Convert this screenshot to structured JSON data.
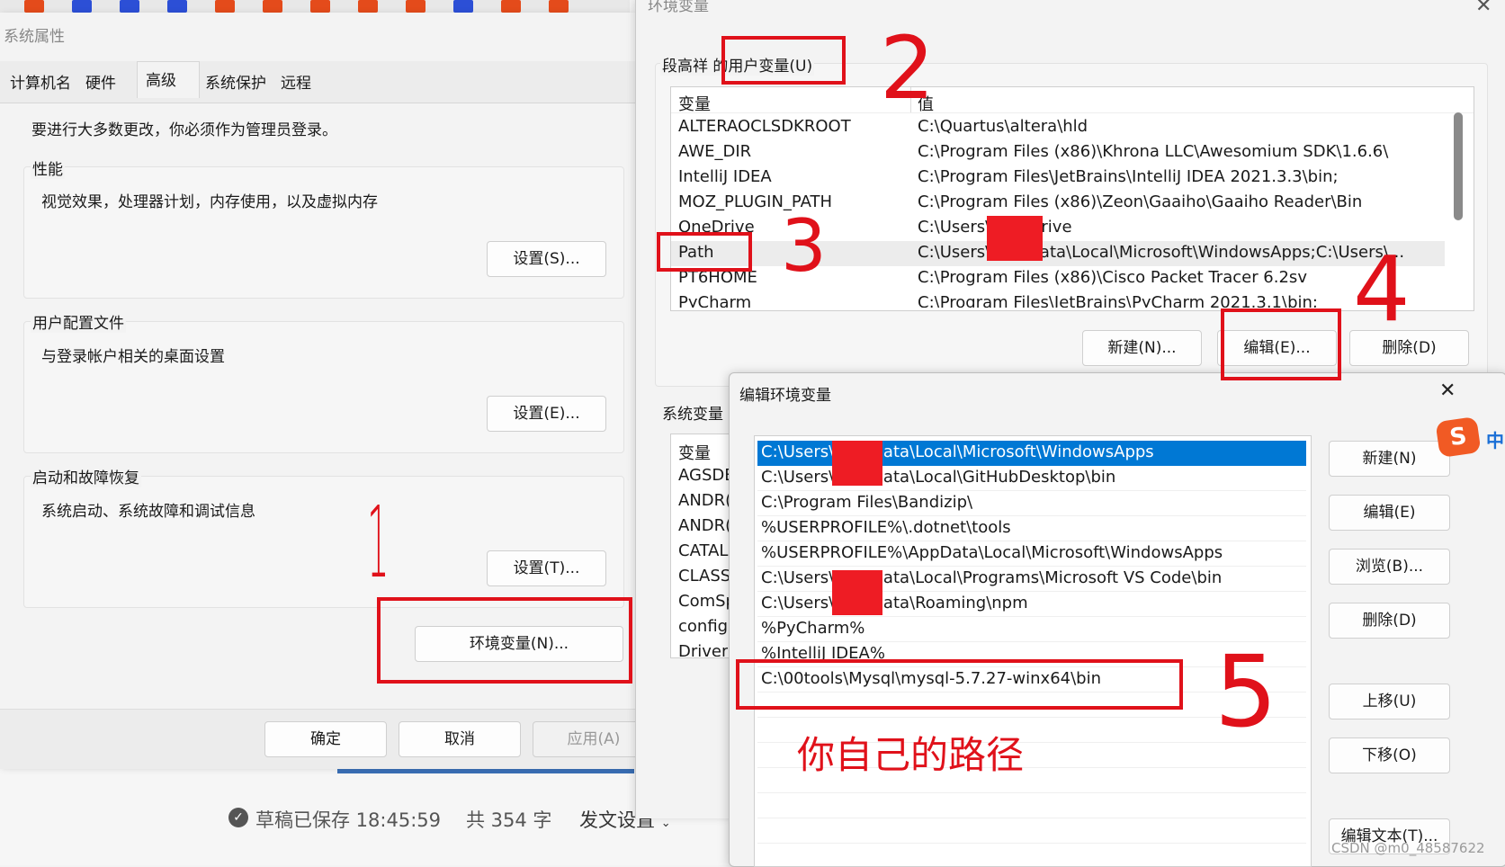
{
  "sys_props": {
    "title": "系统属性",
    "tabs": [
      "计算机名",
      "硬件",
      "高级",
      "系统保护",
      "远程"
    ],
    "admin_note": "要进行大多数更改，你必须作为管理员登录。",
    "perf": {
      "title": "性能",
      "desc": "视觉效果，处理器计划，内存使用，以及虚拟内存",
      "button": "设置(S)..."
    },
    "profile": {
      "title": "用户配置文件",
      "desc": "与登录帐户相关的桌面设置",
      "button": "设置(E)..."
    },
    "startup": {
      "title": "启动和故障恢复",
      "desc": "系统启动、系统故障和调试信息",
      "button": "设置(T)..."
    },
    "env_button": "环境变量(N)...",
    "ok": "确定",
    "cancel": "取消",
    "apply": "应用(A)"
  },
  "env_vars": {
    "title": "环境变量",
    "user_section": "段高祥 的用户变量(U)",
    "col_var": "变量",
    "col_val": "值",
    "user_rows": [
      {
        "name": "ALTERAOCLSDKROOT",
        "value": "C:\\Quartus\\altera\\hld"
      },
      {
        "name": "AWE_DIR",
        "value": "C:\\Program Files (x86)\\Khrona LLC\\Awesomium SDK\\1.6.6\\"
      },
      {
        "name": "IntelliJ IDEA",
        "value": "C:\\Program Files\\JetBrains\\IntelliJ IDEA 2021.3.3\\bin;"
      },
      {
        "name": "MOZ_PLUGIN_PATH",
        "value": "C:\\Program Files (x86)\\Zeon\\Gaaiho\\Gaaiho Reader\\Bin"
      },
      {
        "name": "OneDrive",
        "value": "C:\\Users\\          OneDrive"
      },
      {
        "name": "Path",
        "value": "C:\\Users\\          AppData\\Local\\Microsoft\\WindowsApps;C:\\Users\\..."
      },
      {
        "name": "PT6HOME",
        "value": "C:\\Program Files (x86)\\Cisco Packet Tracer 6.2sv"
      },
      {
        "name": "PyCharm",
        "value": "C:\\Program Files\\JetBrains\\PyCharm 2021.3.1\\bin;"
      }
    ],
    "new_btn": "新建(N)...",
    "edit_btn": "编辑(E)...",
    "delete_btn": "删除(D)",
    "sys_section": "系统变量",
    "sys_col_var": "变量",
    "sys_rows": [
      "AGSDE",
      "ANDR(",
      "ANDR(",
      "CATAL",
      "CLASS",
      "ComSp",
      "config",
      "Driver"
    ]
  },
  "edit_dialog": {
    "title": "编辑环境变量",
    "rows": [
      "C:\\Users\\          AppData\\Local\\Microsoft\\WindowsApps",
      "C:\\Users\\          AppData\\Local\\GitHubDesktop\\bin",
      "C:\\Program Files\\Bandizip\\",
      "%USERPROFILE%\\.dotnet\\tools",
      "%USERPROFILE%\\AppData\\Local\\Microsoft\\WindowsApps",
      "C:\\Users\\          AppData\\Local\\Programs\\Microsoft VS Code\\bin",
      "C:\\Users\\          AppData\\Roaming\\npm",
      "%PyCharm%",
      "%IntelliJ IDEA%",
      "C:\\00tools\\Mysql\\mysql-5.7.27-winx64\\bin"
    ],
    "buttons": [
      "新建(N)",
      "编辑(E)",
      "浏览(B)...",
      "删除(D)",
      "上移(U)",
      "下移(O)",
      "编辑文本(T)..."
    ],
    "annotation": "你自己的路径"
  },
  "annotations": {
    "n1": "1",
    "n2": "2",
    "n3": "3",
    "n4": "4",
    "n5": "5"
  },
  "status_bar": {
    "saved": "草稿已保存 18:45:59",
    "count": "共 354 字",
    "publish": "发文设置"
  },
  "ime": {
    "label": "中"
  },
  "watermark": "CSDN @m0_48587622",
  "colors": {
    "annotation_red": "#e0111a",
    "selection_blue": "#0078d4",
    "redact": "#ee1c24"
  }
}
